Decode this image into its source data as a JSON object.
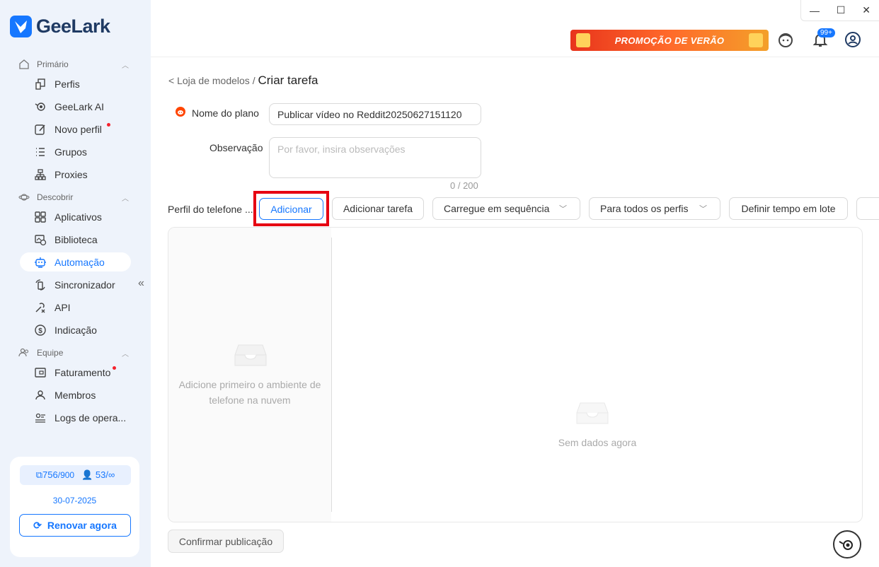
{
  "app": {
    "name": "GeeLark"
  },
  "window": {
    "minimize": "—",
    "maximize": "☐",
    "close": "✕"
  },
  "sidebar": {
    "sections": [
      {
        "title": "Primário",
        "items": [
          "Perfis",
          "GeeLark AI",
          "Novo perfil",
          "Grupos",
          "Proxies"
        ]
      },
      {
        "title": "Descobrir",
        "items": [
          "Aplicativos",
          "Biblioteca",
          "Automação",
          "Sincronizador",
          "API",
          "Indicação"
        ]
      },
      {
        "title": "Equipe",
        "items": [
          "Faturamento",
          "Membros",
          "Logs de opera..."
        ]
      }
    ],
    "active": "Automação",
    "quota": {
      "profiles_used": "756",
      "profiles_total": "/900",
      "members_used": "53",
      "members_total": "/∞"
    },
    "expiry_date": "30-07-2025",
    "renew_label": "Renovar agora"
  },
  "topbar": {
    "promo": "PROMOÇÃO DE VERÃO",
    "notifications_badge": "99+"
  },
  "breadcrumb": {
    "parent": "< Loja de modelos",
    "separator": " / ",
    "current": "Criar tarefa"
  },
  "form": {
    "plan_label": "Nome do plano",
    "plan_value": "Publicar vídeo no Reddit20250627151120",
    "notes_label": "Observação",
    "notes_placeholder": "Por favor, insira observações",
    "notes_counter": "0 / 200",
    "profile_label": "Perfil do telefone ..."
  },
  "toolbar": {
    "add": "Adicionar",
    "add_task": "Adicionar tarefa",
    "upload_mode": "Carregue em sequência",
    "apply_to": "Para todos os perfis",
    "batch_time": "Definir tempo em lote"
  },
  "panel": {
    "left_empty": "Adicione primeiro o ambiente de telefone na nuvem",
    "right_empty": "Sem dados agora"
  },
  "footer": {
    "confirm": "Confirmar publicação"
  },
  "colors": {
    "accent": "#1677ff",
    "highlight": "#e60012",
    "sidebar_bg": "#eef3fb"
  }
}
